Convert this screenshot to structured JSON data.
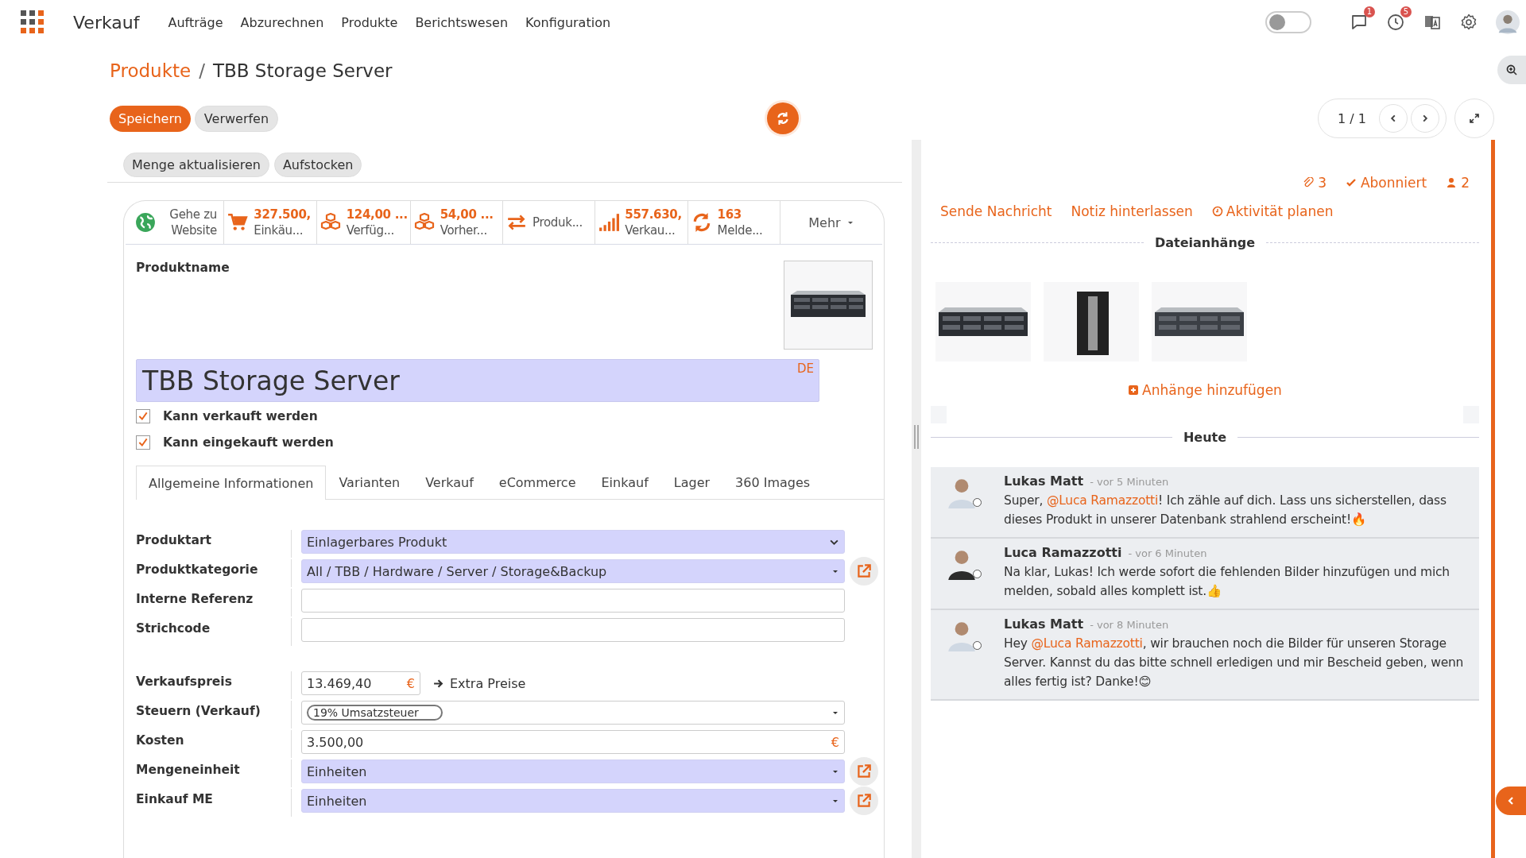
{
  "app": {
    "name": "Verkauf",
    "menu": [
      "Aufträge",
      "Abzurechnen",
      "Produkte",
      "Berichtswesen",
      "Konfiguration"
    ]
  },
  "systray": {
    "toggle": {
      "on": false
    },
    "messages_count": "1",
    "activities_count": "5"
  },
  "breadcrumb": {
    "parent": "Produkte",
    "separator": "/",
    "current": "TBB Storage Server"
  },
  "buttons": {
    "save": "Speichern",
    "discard": "Verwerfen"
  },
  "pager": "1 / 1",
  "actions": [
    "Menge aktualisieren",
    "Aufstocken"
  ],
  "stat_buttons": [
    {
      "kind": "globe",
      "label": "Gehe zu Website"
    },
    {
      "kind": "cart",
      "value": "327.500,",
      "label": "Einkäu..."
    },
    {
      "kind": "boxes",
      "value": "124,00 ...",
      "label": "Verfüg..."
    },
    {
      "kind": "boxes",
      "value": "54,00 ...",
      "label": "Vorher..."
    },
    {
      "kind": "arrows",
      "label": "Produk..."
    },
    {
      "kind": "chart",
      "value": "557.630,",
      "label": "Verkau..."
    },
    {
      "kind": "refresh",
      "value": "163",
      "label": "Melde..."
    }
  ],
  "more": "Mehr",
  "product": {
    "name_label": "Produktname",
    "name": "TBB Storage Server",
    "lang": "DE"
  },
  "options": [
    {
      "label": "Kann verkauft werden",
      "checked": true
    },
    {
      "label": "Kann eingekauft werden",
      "checked": true
    }
  ],
  "tabs": [
    {
      "label": "Allgemeine Informationen",
      "selected": true
    },
    {
      "label": "Varianten",
      "selected": false
    },
    {
      "label": "Verkauf",
      "selected": false
    },
    {
      "label": "eCommerce",
      "selected": false
    },
    {
      "label": "Einkauf",
      "selected": false
    },
    {
      "label": "Lager",
      "selected": false
    },
    {
      "label": "360 Images",
      "selected": false
    }
  ],
  "field_groups": [
    [
      {
        "kind": "select",
        "label": "Produktart",
        "value": "Einlagerbares Produkt",
        "required": true
      },
      {
        "kind": "many2one",
        "label": "Produktkategorie",
        "value": "All / TBB / Hardware / Server / Storage&Backup",
        "required": true
      },
      {
        "kind": "char",
        "label": "Interne Referenz",
        "required": false
      },
      {
        "kind": "char",
        "label": "Strichcode",
        "required": false
      }
    ],
    [
      {
        "kind": "monetary",
        "label": "Verkaufspreis",
        "value": "13.469,40",
        "currency": "€",
        "extra": "Extra Preise",
        "required": false
      },
      {
        "kind": "tags",
        "label": "Steuern (Verkauf)",
        "tags": [
          "19% Umsatzsteuer"
        ],
        "required": false
      },
      {
        "kind": "monetary",
        "label": "Kosten",
        "value": "3.500,00",
        "currency": "€",
        "required": false
      },
      {
        "kind": "many2one",
        "label": "Mengeneinheit",
        "value": "Einheiten",
        "required": true
      },
      {
        "kind": "many2one",
        "label": "Einkauf ME",
        "value": "Einheiten",
        "required": true
      }
    ]
  ],
  "chatter": {
    "attachments_count": "3",
    "follow": "Abonniert",
    "followers_count": "2",
    "actions": [
      {
        "kind": "message",
        "label": "Sende Nachricht"
      },
      {
        "kind": "note",
        "label": "Notiz hinterlassen"
      },
      {
        "kind": "activity",
        "label": "Aktivität planen"
      }
    ],
    "attachments_title": "Dateianhänge",
    "add_attachment": "Anhänge hinzufügen",
    "date_separator": "Heute",
    "messages": [
      {
        "author": "Lukas Matt",
        "time": "- vor 5 Minuten",
        "body": [
          {
            "kind": "text",
            "text": "Super, "
          },
          {
            "kind": "mention",
            "text": "@Luca Ramazzotti"
          },
          {
            "kind": "text",
            "text": "! Ich zähle auf dich. Lass uns sicherstellen, dass dieses Produkt in unserer Datenbank strahlend erscheint!🔥"
          }
        ]
      },
      {
        "author": "Luca Ramazzotti",
        "time": "- vor 6 Minuten",
        "body": [
          {
            "kind": "text",
            "text": "Na klar, Lukas! Ich werde sofort die fehlenden Bilder hinzufügen und mich melden, sobald alles komplett ist.👍"
          }
        ]
      },
      {
        "author": "Lukas Matt",
        "time": "- vor 8 Minuten",
        "body": [
          {
            "kind": "text",
            "text": "Hey "
          },
          {
            "kind": "mention",
            "text": "@Luca Ramazzotti"
          },
          {
            "kind": "text",
            "text": ", wir brauchen noch die Bilder für unseren Storage Server. Kannst du das bitte schnell erledigen und mir Bescheid geben, wenn alles fertig ist? Danke!😊"
          }
        ]
      }
    ]
  }
}
